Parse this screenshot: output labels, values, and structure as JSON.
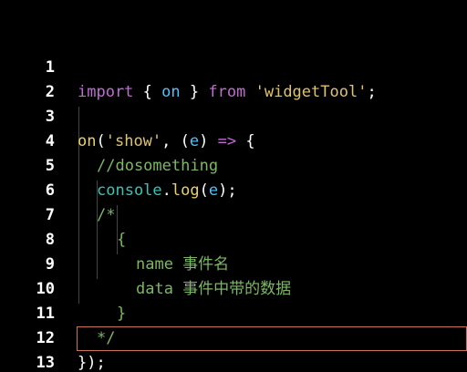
{
  "editor": {
    "lines": [
      {
        "number": "1"
      },
      {
        "number": "2"
      },
      {
        "number": "3"
      },
      {
        "number": "4"
      },
      {
        "number": "5"
      },
      {
        "number": "6"
      },
      {
        "number": "7"
      },
      {
        "number": "8"
      },
      {
        "number": "9"
      },
      {
        "number": "10"
      },
      {
        "number": "11"
      },
      {
        "number": "12"
      },
      {
        "number": "13"
      }
    ],
    "tokens": {
      "import_kw": "import",
      "brace_open": "{",
      "on_name": "on",
      "brace_close": "}",
      "from_kw": "from",
      "module_str": "'widgetTool'",
      "semicolon": ";",
      "on_call": "on",
      "paren_open": "(",
      "event_str": "'show'",
      "comma": ",",
      "param_open": "(",
      "param_e": "e",
      "param_close": ")",
      "arrow": "=>",
      "block_open": "{",
      "comment_line": "//dosomething",
      "console_obj": "console",
      "dot": ".",
      "log_method": "log",
      "log_open": "(",
      "log_arg": "e",
      "log_close": ");",
      "block_comment_open": "/*",
      "comment_brace_open": "{",
      "comment_name_line": "name 事件名",
      "comment_data_line": "data 事件中带的数据",
      "comment_brace_close": "}",
      "block_comment_close": "*/",
      "closing": "});"
    },
    "colors": {
      "background": "#000000",
      "keyword": "#c26ad6",
      "string": "#e0c36e",
      "variable": "#4fc1ff",
      "comment": "#7cb766",
      "active_line_border": "#c8735a"
    }
  }
}
